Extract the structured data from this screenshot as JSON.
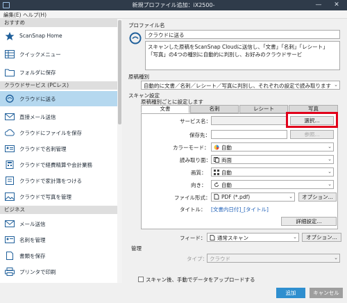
{
  "window": {
    "title": "新規プロファイル追加：iX2500-",
    "controls": [
      "—",
      "✕"
    ]
  },
  "menu": [
    "編集(E)",
    "ヘルプ(H)"
  ],
  "sidebar": {
    "sections": [
      {
        "header": "おすすめ",
        "items": [
          {
            "label": "ScanSnap Home",
            "icon": "star-icon"
          },
          {
            "label": "クイックメニュー",
            "icon": "grid-menu-icon"
          },
          {
            "label": "フォルダに保存",
            "icon": "folder-icon"
          }
        ]
      },
      {
        "header": "クラウドサービス (PCレス)",
        "items": [
          {
            "label": "クラウドに送る",
            "icon": "cloud-send-icon",
            "active": true
          },
          {
            "label": "直接メール送信",
            "icon": "mail-icon"
          },
          {
            "label": "クラウドにファイルを保存",
            "icon": "cloud-file-icon"
          },
          {
            "label": "クラウドで名刺管理",
            "icon": "business-card-icon"
          },
          {
            "label": "クラウドで経費精算や会計業務",
            "icon": "calculator-icon"
          },
          {
            "label": "クラウドで家計簿をつける",
            "icon": "household-book-icon"
          },
          {
            "label": "クラウドで写真を管理",
            "icon": "photo-icon"
          }
        ]
      },
      {
        "header": "ビジネス",
        "items": [
          {
            "label": "メール送信",
            "icon": "mail-icon"
          },
          {
            "label": "名刺を管理",
            "icon": "business-card-icon"
          },
          {
            "label": "書類を保存",
            "icon": "document-icon"
          },
          {
            "label": "プリンタで印刷",
            "icon": "printer-icon"
          }
        ]
      }
    ]
  },
  "main": {
    "profile_name_label": "プロファイル名",
    "profile_name_value": "クラウドに送る",
    "profile_description": "スキャンした原稿をScanSnap Cloudに送信し、「文書」「名刺」「レシート」「写真」の4つの種別に自動的に判別し、お好みのクラウドサービ",
    "doc_type_label": "原稿種別",
    "doc_type_value": "自動的に文書／名刺／レシート／写真に判別し、それぞれの設定で読み取ります",
    "scan_settings_label": "スキャン設定",
    "per_type_label": "原稿種別ごとに設定します",
    "tabs": [
      "文書",
      "名刺",
      "レシート",
      "写真"
    ],
    "service_name_label": "サービス名：",
    "select_button": "選択...",
    "save_to_label": "保存先：",
    "browse_button": "参照...",
    "color_mode_label": "カラーモード：",
    "color_mode_value": "自動",
    "scan_side_label": "読み取り面：",
    "scan_side_value": "両面",
    "quality_label": "画質：",
    "quality_value": "自動",
    "orientation_label": "向き：",
    "orientation_value": "自動",
    "file_format_label": "ファイル形式：",
    "file_format_value": "PDF (*.pdf)",
    "option_button": "オプション...",
    "title_label": "タイトル：",
    "title_value": "[文書内日付]_[タイトル]",
    "detail_button": "詳細設定...",
    "feed_label": "フィード：",
    "feed_value": "通常スキャン",
    "feed_option_button": "オプション...",
    "manage_label": "管理",
    "type_label": "タイプ：",
    "type_value": "クラウド",
    "upload_checkbox_label": "スキャン後、手動でデータをアップロードする"
  },
  "footer": {
    "add_button": "追加",
    "cancel_button": "キャンセル"
  },
  "colors": {
    "titlebar": "#2f3b4a",
    "active_item": "#b5d8ef",
    "primary": "#2f8fcf",
    "highlight": "#e1001a"
  }
}
